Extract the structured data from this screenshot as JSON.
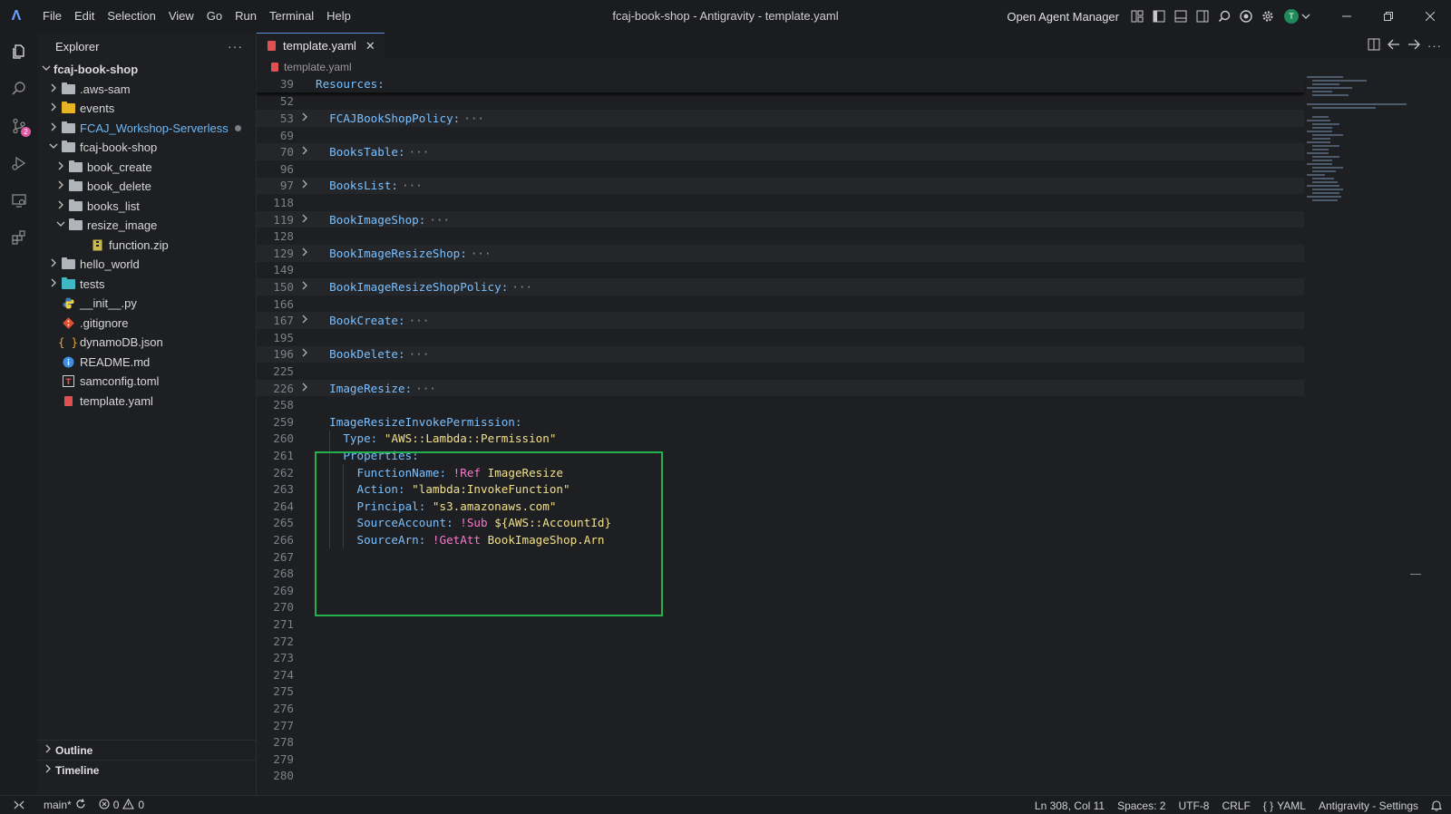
{
  "titlebar": {
    "menu": [
      "File",
      "Edit",
      "Selection",
      "View",
      "Go",
      "Run",
      "Terminal",
      "Help"
    ],
    "window_title": "fcaj-book-shop - Antigravity - template.yaml",
    "agent_manager_label": "Open Agent Manager",
    "avatar_initial": "T"
  },
  "activity_bar": {
    "scm_badge": "2"
  },
  "sidebar": {
    "title": "Explorer",
    "more": "···",
    "tree": [
      {
        "label": "fcaj-book-shop",
        "depth": 0,
        "type": "root",
        "expanded": true
      },
      {
        "label": ".aws-sam",
        "depth": 1,
        "type": "folder",
        "expanded": false,
        "color": "gray"
      },
      {
        "label": "events",
        "depth": 1,
        "type": "folder",
        "expanded": false,
        "color": "yellow"
      },
      {
        "label": "FCAJ_Workshop-Serverless",
        "depth": 1,
        "type": "folder",
        "expanded": false,
        "color": "gray",
        "modified": true
      },
      {
        "label": "fcaj-book-shop",
        "depth": 1,
        "type": "folder",
        "expanded": true,
        "color": "gray"
      },
      {
        "label": "book_create",
        "depth": 2,
        "type": "folder",
        "expanded": false,
        "color": "gray"
      },
      {
        "label": "book_delete",
        "depth": 2,
        "type": "folder",
        "expanded": false,
        "color": "gray"
      },
      {
        "label": "books_list",
        "depth": 2,
        "type": "folder",
        "expanded": false,
        "color": "gray"
      },
      {
        "label": "resize_image",
        "depth": 2,
        "type": "folder",
        "expanded": true,
        "color": "gray"
      },
      {
        "label": "function.zip",
        "depth": 3,
        "type": "zip"
      },
      {
        "label": "hello_world",
        "depth": 1,
        "type": "folder",
        "expanded": false,
        "color": "gray"
      },
      {
        "label": "tests",
        "depth": 1,
        "type": "folder",
        "expanded": false,
        "color": "teal"
      },
      {
        "label": "__init__.py",
        "depth": 1,
        "type": "python"
      },
      {
        "label": ".gitignore",
        "depth": 1,
        "type": "git"
      },
      {
        "label": "dynamoDB.json",
        "depth": 1,
        "type": "json"
      },
      {
        "label": "README.md",
        "depth": 1,
        "type": "info"
      },
      {
        "label": "samconfig.toml",
        "depth": 1,
        "type": "toml"
      },
      {
        "label": "template.yaml",
        "depth": 1,
        "type": "yaml"
      }
    ],
    "outline_label": "Outline",
    "timeline_label": "Timeline"
  },
  "editor": {
    "tab_label": "template.yaml",
    "breadcrumb": "template.yaml",
    "sticky_line": {
      "num": "39",
      "text": "Resources:"
    },
    "lines": [
      {
        "num": "52",
        "key": "",
        "fold": false
      },
      {
        "num": "53",
        "key": "FCAJBookShopPolicy:",
        "fold": true
      },
      {
        "num": "69",
        "key": "",
        "fold": false
      },
      {
        "num": "70",
        "key": "BooksTable:",
        "fold": true
      },
      {
        "num": "96",
        "key": "",
        "fold": false
      },
      {
        "num": "97",
        "key": "BooksList:",
        "fold": true
      },
      {
        "num": "118",
        "key": "",
        "fold": false
      },
      {
        "num": "119",
        "key": "BookImageShop:",
        "fold": true
      },
      {
        "num": "128",
        "key": "",
        "fold": false
      },
      {
        "num": "129",
        "key": "BookImageResizeShop:",
        "fold": true
      },
      {
        "num": "149",
        "key": "",
        "fold": false
      },
      {
        "num": "150",
        "key": "BookImageResizeShopPolicy:",
        "fold": true
      },
      {
        "num": "166",
        "key": "",
        "fold": false
      },
      {
        "num": "167",
        "key": "BookCreate:",
        "fold": true
      },
      {
        "num": "195",
        "key": "",
        "fold": false
      },
      {
        "num": "196",
        "key": "BookDelete:",
        "fold": true
      },
      {
        "num": "225",
        "key": "",
        "fold": false
      },
      {
        "num": "226",
        "key": "ImageResize:",
        "fold": true
      },
      {
        "num": "258",
        "key": "",
        "fold": false
      }
    ],
    "permission_block": [
      {
        "num": "259",
        "indent": "  ",
        "key": "ImageResizeInvokePermission:",
        "tag": "",
        "value": ""
      },
      {
        "num": "260",
        "indent": "    ",
        "key": "Type:",
        "tag": "",
        "value": "\"AWS::Lambda::Permission\""
      },
      {
        "num": "261",
        "indent": "    ",
        "key": "Properties:",
        "tag": "",
        "value": ""
      },
      {
        "num": "262",
        "indent": "      ",
        "key": "FunctionName:",
        "tag": "!Ref",
        "value": "ImageResize"
      },
      {
        "num": "263",
        "indent": "      ",
        "key": "Action:",
        "tag": "",
        "value": "\"lambda:InvokeFunction\""
      },
      {
        "num": "264",
        "indent": "      ",
        "key": "Principal:",
        "tag": "",
        "value": "\"s3.amazonaws.com\""
      },
      {
        "num": "265",
        "indent": "      ",
        "key": "SourceAccount:",
        "tag": "!Sub",
        "value": "${AWS::AccountId}"
      },
      {
        "num": "266",
        "indent": "      ",
        "key": "SourceArn:",
        "tag": "!GetAtt",
        "value": "BookImageShop.Arn"
      }
    ],
    "trailing_lines": [
      "267",
      "268",
      "269",
      "270",
      "271",
      "272",
      "273",
      "274",
      "275",
      "276",
      "277",
      "278",
      "279",
      "280"
    ],
    "fold_ellipsis": "···"
  },
  "statusbar": {
    "branch": "main*",
    "errors": "0",
    "warnings": "0",
    "cursor": "Ln 308, Col 11",
    "spaces": "Spaces: 2",
    "encoding": "UTF-8",
    "eol": "CRLF",
    "language": "YAML",
    "settings": "Antigravity - Settings"
  },
  "colors": {
    "highlight_border": "#22b14c",
    "yaml_key": "#79c0ff",
    "yaml_string": "#f2e089",
    "yaml_tag": "#f47acb"
  }
}
